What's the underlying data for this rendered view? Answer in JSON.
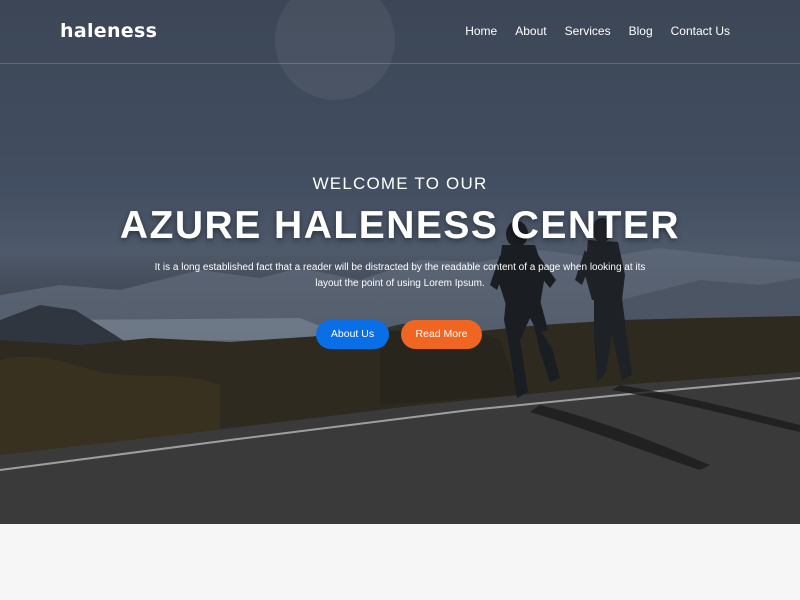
{
  "brand": {
    "logo_text": "haleness"
  },
  "nav": {
    "items": [
      {
        "label": "Home"
      },
      {
        "label": "About"
      },
      {
        "label": "Services"
      },
      {
        "label": "Blog"
      },
      {
        "label": "Contact Us"
      }
    ]
  },
  "hero": {
    "subtitle": "WELCOME TO OUR",
    "title": "AZURE HALENESS CENTER",
    "description": "It is a long established fact that a reader will be distracted by the readable content of a page when looking at its layout the point of using Lorem Ipsum.",
    "buttons": {
      "about_label": "About Us",
      "read_more_label": "Read More"
    }
  },
  "colors": {
    "primary_button": "#0a6ee6",
    "secondary_button": "#f06521",
    "footer_background": "#f6f6f6"
  },
  "icons": [
    "background-photo-runners"
  ]
}
